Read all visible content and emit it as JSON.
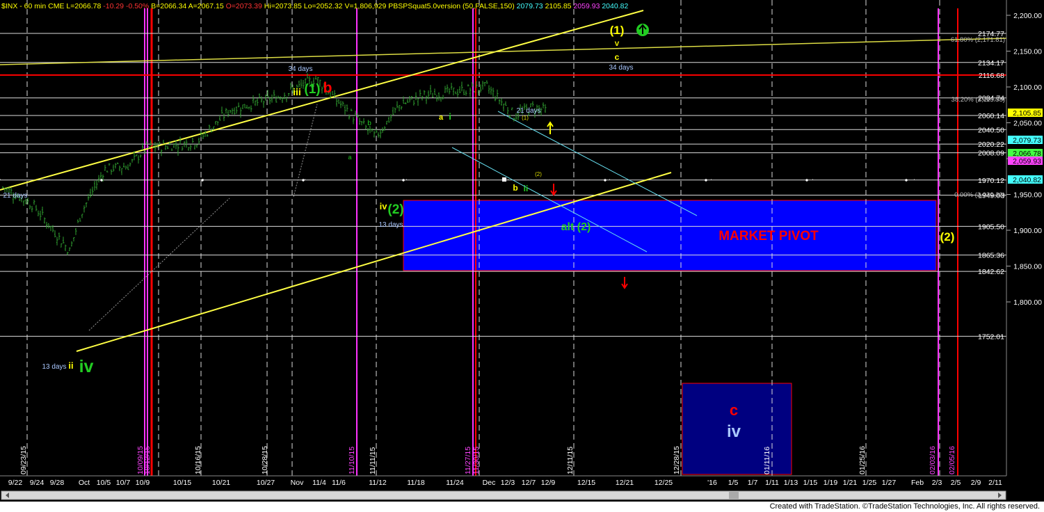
{
  "header": {
    "symbol": "$INX - 60 min",
    "exchange": "CME",
    "last": "L=2066.78",
    "change": "-10.29",
    "pct": "-0.50%",
    "bid": "B=2066.34",
    "ask": "A=2067.15",
    "open": "O=2073.39",
    "high": "Hi=2073.85",
    "low": "Lo=2052.32",
    "volume": "V=1,806,929",
    "indicator": "PBSPSquat5.0version (50,FALSE,150)",
    "ind_v1": "2079.73",
    "ind_v2": "2105.85",
    "ind_v3": "2059.93",
    "ind_v4": "2040.82"
  },
  "footer": {
    "credit": "Created with TradeStation. ©TradeStation Technologies, Inc. All rights reserved."
  },
  "colors": {
    "background": "#000000",
    "price_bars": "#2f9e2f",
    "trendline": "#ffff44",
    "pivot_box": "#0000ff",
    "magenta": "#ff33ff",
    "red": "#ff0000",
    "cyan": "#66ddee"
  },
  "chart_data": {
    "type": "candlestick",
    "title": "$INX - 60 min",
    "ylim": [
      1740,
      2215
    ],
    "y_ticks": [
      "2,200.00",
      "2,150.00",
      "2,100.00",
      "2,050.00",
      "2,000.00",
      "1,950.00",
      "1,900.00",
      "1,850.00",
      "1,800.00"
    ],
    "x_ticks": [
      "9/22",
      "9/24",
      "9/28",
      "Oct",
      "10/5",
      "10/7",
      "10/9",
      "10/15",
      "10/21",
      "10/27",
      "Nov",
      "11/4",
      "11/6",
      "11/12",
      "11/18",
      "11/24",
      "Dec",
      "12/3",
      "12/7",
      "12/9",
      "12/15",
      "12/21",
      "12/25",
      "'16",
      "1/5",
      "1/7",
      "1/11",
      "1/13",
      "1/15",
      "1/19",
      "1/21",
      "1/25",
      "1/27",
      "Feb",
      "2/3",
      "2/5",
      "2/9",
      "2/11"
    ],
    "price_levels": [
      {
        "value": 2174.77,
        "label": "2174.77"
      },
      {
        "value": 2134.17,
        "label": "2134.17"
      },
      {
        "value": 2116.68,
        "label": "2116.68"
      },
      {
        "value": 2084.74,
        "label": "2084.74"
      },
      {
        "value": 2060.14,
        "label": "2060.14"
      },
      {
        "value": 2040.5,
        "label": "2040.50"
      },
      {
        "value": 2020.22,
        "label": "2020.22"
      },
      {
        "value": 2008.09,
        "label": "2008.09"
      },
      {
        "value": 1970.12,
        "label": "1970.12"
      },
      {
        "value": 1949.03,
        "label": "1949.03"
      },
      {
        "value": 1905.5,
        "label": "1905.50"
      },
      {
        "value": 1865.36,
        "label": "1865.36"
      },
      {
        "value": 1842.62,
        "label": "1842.62"
      },
      {
        "value": 1752.01,
        "label": "1752.01"
      }
    ],
    "price_tags": [
      {
        "value": 2105.85,
        "label": "2,105.85",
        "color": "#ffff00"
      },
      {
        "value": 2079.73,
        "label": "2,079.73",
        "color": "#44ffff"
      },
      {
        "value": 2066.78,
        "label": "2,066.78",
        "color": "#44ff44"
      },
      {
        "value": 2059.93,
        "label": "2,059.93",
        "color": "#ff44ff"
      },
      {
        "value": 2040.82,
        "label": "2,040.82",
        "color": "#44ffff"
      }
    ],
    "fib_labels": [
      {
        "label": "61.80% (2,171.81)",
        "value": 2171.81
      },
      {
        "label": "38.20% (2,113.58)",
        "value": 2113.58
      },
      {
        "label": "0.00% (2,020.22)",
        "value": 2020.22
      }
    ],
    "date_markers": [
      "09/23/15",
      "10/09/15",
      "10/12/15",
      "10/16/15",
      "10/28/15",
      "11/10/15",
      "11/11/15",
      "11/27/15",
      "11/30/15",
      "12/11/15",
      "12/28/15",
      "01/11/16",
      "01/25/16",
      "02/03/16",
      "02/05/16"
    ],
    "wave_labels": [
      "(1)",
      "v",
      "c",
      "34 days",
      "34 days",
      "iii",
      "(1)",
      "b",
      "a",
      "i",
      "b",
      "a",
      "21 days",
      "(1)",
      "(2)",
      "b",
      "ii",
      "iv",
      "(2)",
      "13 days",
      "alt (2)",
      "21 days",
      "13 days",
      "ii",
      "iv",
      "(2)",
      "c",
      "iv"
    ],
    "boxes": [
      {
        "label": "MARKET PIVOT",
        "y_range": [
          1949.03,
          2020.22
        ]
      }
    ],
    "series": [
      {
        "values": [
          {
            "x": "9/22",
            "close": 1960
          },
          {
            "x": "9/24",
            "close": 1935
          },
          {
            "x": "9/28",
            "close": 1871
          },
          {
            "x": "Oct",
            "close": 1925
          },
          {
            "x": "10/5",
            "close": 1985
          },
          {
            "x": "10/7",
            "close": 1990
          },
          {
            "x": "10/9",
            "close": 2015
          },
          {
            "x": "10/15",
            "close": 2020
          },
          {
            "x": "10/21",
            "close": 2025
          },
          {
            "x": "10/27",
            "close": 2068
          },
          {
            "x": "Nov",
            "close": 2086
          },
          {
            "x": "11/4",
            "close": 2112
          },
          {
            "x": "11/6",
            "close": 2085
          },
          {
            "x": "11/12",
            "close": 2030
          },
          {
            "x": "11/18",
            "close": 2075
          },
          {
            "x": "11/24",
            "close": 2088
          },
          {
            "x": "Dec",
            "close": 2100
          },
          {
            "x": "12/3",
            "close": 2060
          },
          {
            "x": "12/7",
            "close": 2072
          },
          {
            "x": "12/9",
            "close": 2066.78
          }
        ]
      }
    ]
  }
}
